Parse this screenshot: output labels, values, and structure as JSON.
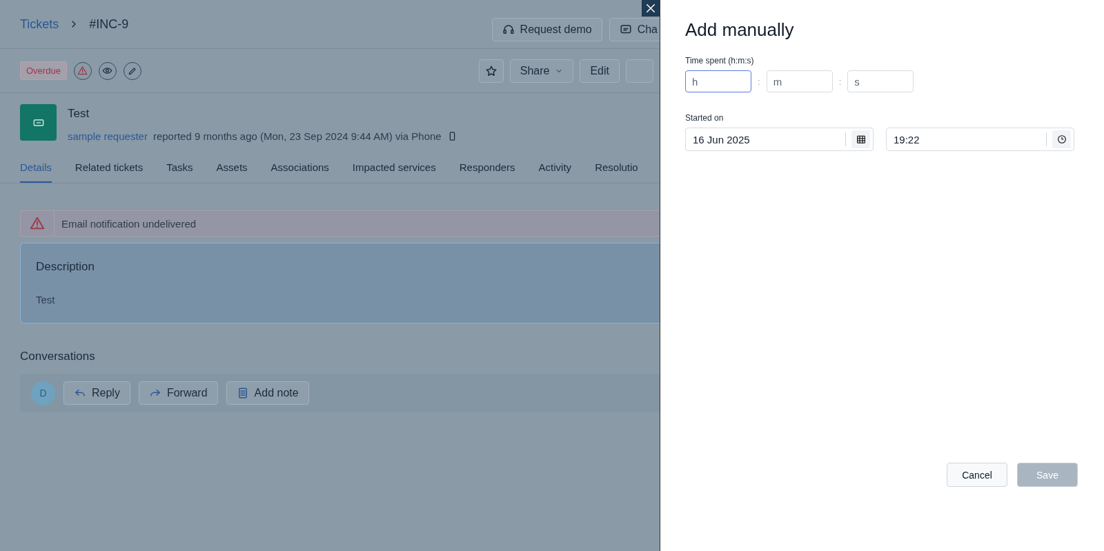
{
  "breadcrumb": {
    "parent": "Tickets",
    "current": "#INC-9"
  },
  "header_buttons": [
    {
      "kind": "headset",
      "label": "Request demo"
    },
    {
      "kind": "chat",
      "label": "Cha"
    }
  ],
  "status_badge": "Overdue",
  "actions": [
    {
      "kind": "dropdown",
      "label": "Share"
    },
    {
      "kind": "plain",
      "label": "Edit"
    }
  ],
  "ticket": {
    "title": "Test",
    "requester": "sample requester",
    "meta": "reported 9 months ago (Mon, 23 Sep 2024 9:44 AM) via Phone"
  },
  "tabs": [
    {
      "label": "Details",
      "selected": true
    },
    {
      "label": "Related tickets",
      "selected": false
    },
    {
      "label": "Tasks",
      "selected": false
    },
    {
      "label": "Assets",
      "selected": false
    },
    {
      "label": "Associations",
      "selected": false
    },
    {
      "label": "Impacted services",
      "selected": false
    },
    {
      "label": "Responders",
      "selected": false
    },
    {
      "label": "Activity",
      "selected": false
    },
    {
      "label": "Resolutio",
      "selected": false
    }
  ],
  "alert": "Email notification undelivered",
  "description": {
    "title": "Description",
    "body": "Test"
  },
  "conversations": {
    "title": "Conversations",
    "avatar": "D",
    "buttons": [
      {
        "kind": "reply",
        "label": "Reply"
      },
      {
        "kind": "forward",
        "label": "Forward"
      },
      {
        "kind": "note",
        "label": "Add note"
      }
    ]
  },
  "drawer": {
    "title": "Add manually",
    "time_label": "Time spent (h:m:s)",
    "time_fields": [
      {
        "placeholder": "h",
        "focused": true
      },
      {
        "placeholder": "m",
        "focused": false
      },
      {
        "placeholder": "s",
        "focused": false
      }
    ],
    "time_separators": [
      ":",
      ":"
    ],
    "started_label": "Started on",
    "date": "16 Jun 2025",
    "time": "19:22",
    "buttons": [
      {
        "label": "Cancel",
        "disabled": false
      },
      {
        "label": "Save",
        "disabled": true
      }
    ]
  }
}
